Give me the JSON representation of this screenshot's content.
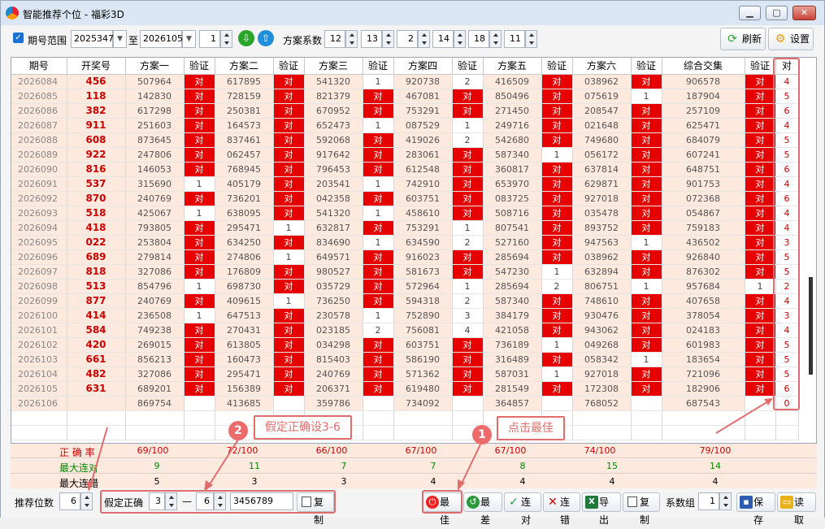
{
  "window": {
    "title": "智能推荐个位 - 福彩3D",
    "min": "▁",
    "max": "▢",
    "close": "✕"
  },
  "toolbar": {
    "range_label": "期号范围",
    "range_checked": "✓",
    "from": "2025347",
    "to_label": "至",
    "to": "2026105",
    "count": "1",
    "coef_label": "方案系数",
    "coefs": [
      "12",
      "13",
      "2",
      "14",
      "18",
      "11"
    ],
    "refresh_label": "刷新",
    "settings_label": "设置"
  },
  "headers": [
    "期号",
    "开奖号",
    "方案一",
    "验证",
    "方案二",
    "验证",
    "方案三",
    "验证",
    "方案四",
    "验证",
    "方案五",
    "验证",
    "方案六",
    "验证",
    "综合交集",
    "验证",
    "对"
  ],
  "rows": [
    [
      "2026084",
      "456",
      "507964",
      "对",
      "617895",
      "对",
      "541320",
      "1",
      "920738",
      "2",
      "416509",
      "对",
      "038962",
      "对",
      "906578",
      "对",
      "4"
    ],
    [
      "2026085",
      "118",
      "142830",
      "对",
      "728159",
      "对",
      "821379",
      "对",
      "467081",
      "对",
      "850496",
      "对",
      "075619",
      "1",
      "187904",
      "对",
      "5"
    ],
    [
      "2026086",
      "382",
      "617298",
      "对",
      "250381",
      "对",
      "670952",
      "对",
      "753291",
      "对",
      "271450",
      "对",
      "208547",
      "对",
      "257109",
      "对",
      "6"
    ],
    [
      "2026087",
      "911",
      "251603",
      "对",
      "164573",
      "对",
      "652473",
      "1",
      "087529",
      "1",
      "249716",
      "对",
      "021648",
      "对",
      "625471",
      "对",
      "4"
    ],
    [
      "2026088",
      "608",
      "873645",
      "对",
      "837461",
      "对",
      "592068",
      "对",
      "419026",
      "2",
      "542680",
      "对",
      "749680",
      "对",
      "684079",
      "对",
      "5"
    ],
    [
      "2026089",
      "922",
      "247806",
      "对",
      "062457",
      "对",
      "917642",
      "对",
      "283061",
      "对",
      "587340",
      "1",
      "056172",
      "对",
      "607241",
      "对",
      "5"
    ],
    [
      "2026090",
      "816",
      "146053",
      "对",
      "768945",
      "对",
      "796453",
      "对",
      "612548",
      "对",
      "360817",
      "对",
      "637814",
      "对",
      "648751",
      "对",
      "6"
    ],
    [
      "2026091",
      "537",
      "315690",
      "1",
      "405179",
      "对",
      "203541",
      "1",
      "742910",
      "对",
      "653970",
      "对",
      "629871",
      "对",
      "901753",
      "对",
      "4"
    ],
    [
      "2026092",
      "870",
      "240769",
      "对",
      "736201",
      "对",
      "042358",
      "对",
      "603751",
      "对",
      "083725",
      "对",
      "927018",
      "对",
      "072368",
      "对",
      "6"
    ],
    [
      "2026093",
      "518",
      "425067",
      "1",
      "638095",
      "对",
      "541320",
      "1",
      "458610",
      "对",
      "508716",
      "对",
      "035478",
      "对",
      "054867",
      "对",
      "4"
    ],
    [
      "2026094",
      "418",
      "793805",
      "对",
      "295471",
      "1",
      "632817",
      "对",
      "753291",
      "1",
      "807541",
      "对",
      "893752",
      "对",
      "759183",
      "对",
      "4"
    ],
    [
      "2026095",
      "022",
      "253804",
      "对",
      "634250",
      "对",
      "834690",
      "1",
      "634590",
      "2",
      "527160",
      "对",
      "947563",
      "1",
      "436502",
      "对",
      "3"
    ],
    [
      "2026096",
      "689",
      "279814",
      "对",
      "274806",
      "1",
      "649571",
      "对",
      "916023",
      "对",
      "285694",
      "对",
      "038962",
      "对",
      "926840",
      "对",
      "5"
    ],
    [
      "2026097",
      "818",
      "327086",
      "对",
      "176809",
      "对",
      "980527",
      "对",
      "581673",
      "对",
      "547230",
      "1",
      "632894",
      "对",
      "876302",
      "对",
      "5"
    ],
    [
      "2026098",
      "513",
      "854796",
      "1",
      "698730",
      "对",
      "035729",
      "对",
      "572964",
      "1",
      "285694",
      "2",
      "806751",
      "1",
      "957684",
      "1",
      "2"
    ],
    [
      "2026099",
      "877",
      "240769",
      "对",
      "409615",
      "1",
      "736250",
      "对",
      "594318",
      "2",
      "587340",
      "对",
      "748610",
      "对",
      "407658",
      "对",
      "4"
    ],
    [
      "2026100",
      "414",
      "236508",
      "1",
      "647513",
      "对",
      "230578",
      "1",
      "752890",
      "3",
      "384179",
      "对",
      "930476",
      "对",
      "378054",
      "对",
      "3"
    ],
    [
      "2026101",
      "584",
      "749238",
      "对",
      "270431",
      "对",
      "023185",
      "2",
      "756081",
      "4",
      "421058",
      "对",
      "943062",
      "对",
      "024183",
      "对",
      "4"
    ],
    [
      "2026102",
      "420",
      "269015",
      "对",
      "613805",
      "对",
      "034298",
      "对",
      "603751",
      "对",
      "736189",
      "1",
      "049268",
      "对",
      "601983",
      "对",
      "5"
    ],
    [
      "2026103",
      "661",
      "856213",
      "对",
      "160473",
      "对",
      "815403",
      "对",
      "586190",
      "对",
      "316489",
      "对",
      "058342",
      "1",
      "183654",
      "对",
      "5"
    ],
    [
      "2026104",
      "482",
      "327086",
      "对",
      "295471",
      "对",
      "240769",
      "对",
      "571362",
      "对",
      "587031",
      "1",
      "927018",
      "对",
      "721096",
      "对",
      "5"
    ],
    [
      "2026105",
      "631",
      "689201",
      "对",
      "156389",
      "对",
      "206371",
      "对",
      "619480",
      "对",
      "281549",
      "对",
      "172308",
      "对",
      "182906",
      "对",
      "6"
    ],
    [
      "2026106",
      "",
      "869754",
      "",
      "413685",
      "",
      "359786",
      "",
      "734092",
      "",
      "364857",
      "",
      "768052",
      "",
      "687543",
      "",
      "0"
    ]
  ],
  "stats": {
    "acc_label": "正 确 率",
    "acc": [
      "69/100",
      "72/100",
      "66/100",
      "67/100",
      "67/100",
      "74/100",
      "79/100"
    ],
    "streak_label": "最大连对",
    "streak": [
      "9",
      "11",
      "7",
      "7",
      "8",
      "15",
      "14"
    ],
    "miss_label": "最大连错",
    "miss": [
      "5",
      "3",
      "3",
      "4",
      "4",
      "4",
      "4"
    ]
  },
  "bottom": {
    "rec_label": "推荐位数",
    "rec_value": "6",
    "assume_label": "假定正确",
    "assume_from": "3",
    "dash": "—",
    "assume_to": "6",
    "digits": "3456789",
    "copy1": "复制",
    "best": "最佳",
    "worst": "最差",
    "lian_dui": "连对",
    "lian_cuo": "连错",
    "export": "导出",
    "copy2": "复制",
    "group_label": "系数组",
    "group_value": "1",
    "save": "保存",
    "load": "读取"
  },
  "annotations": {
    "n1": "1",
    "n1_text": "点击最佳",
    "n2": "2",
    "n2_text": "假定正确设3-6"
  },
  "colors": {
    "hit": "#e60000",
    "row_bg": "#fde9de",
    "annot": "#e06d6d"
  }
}
